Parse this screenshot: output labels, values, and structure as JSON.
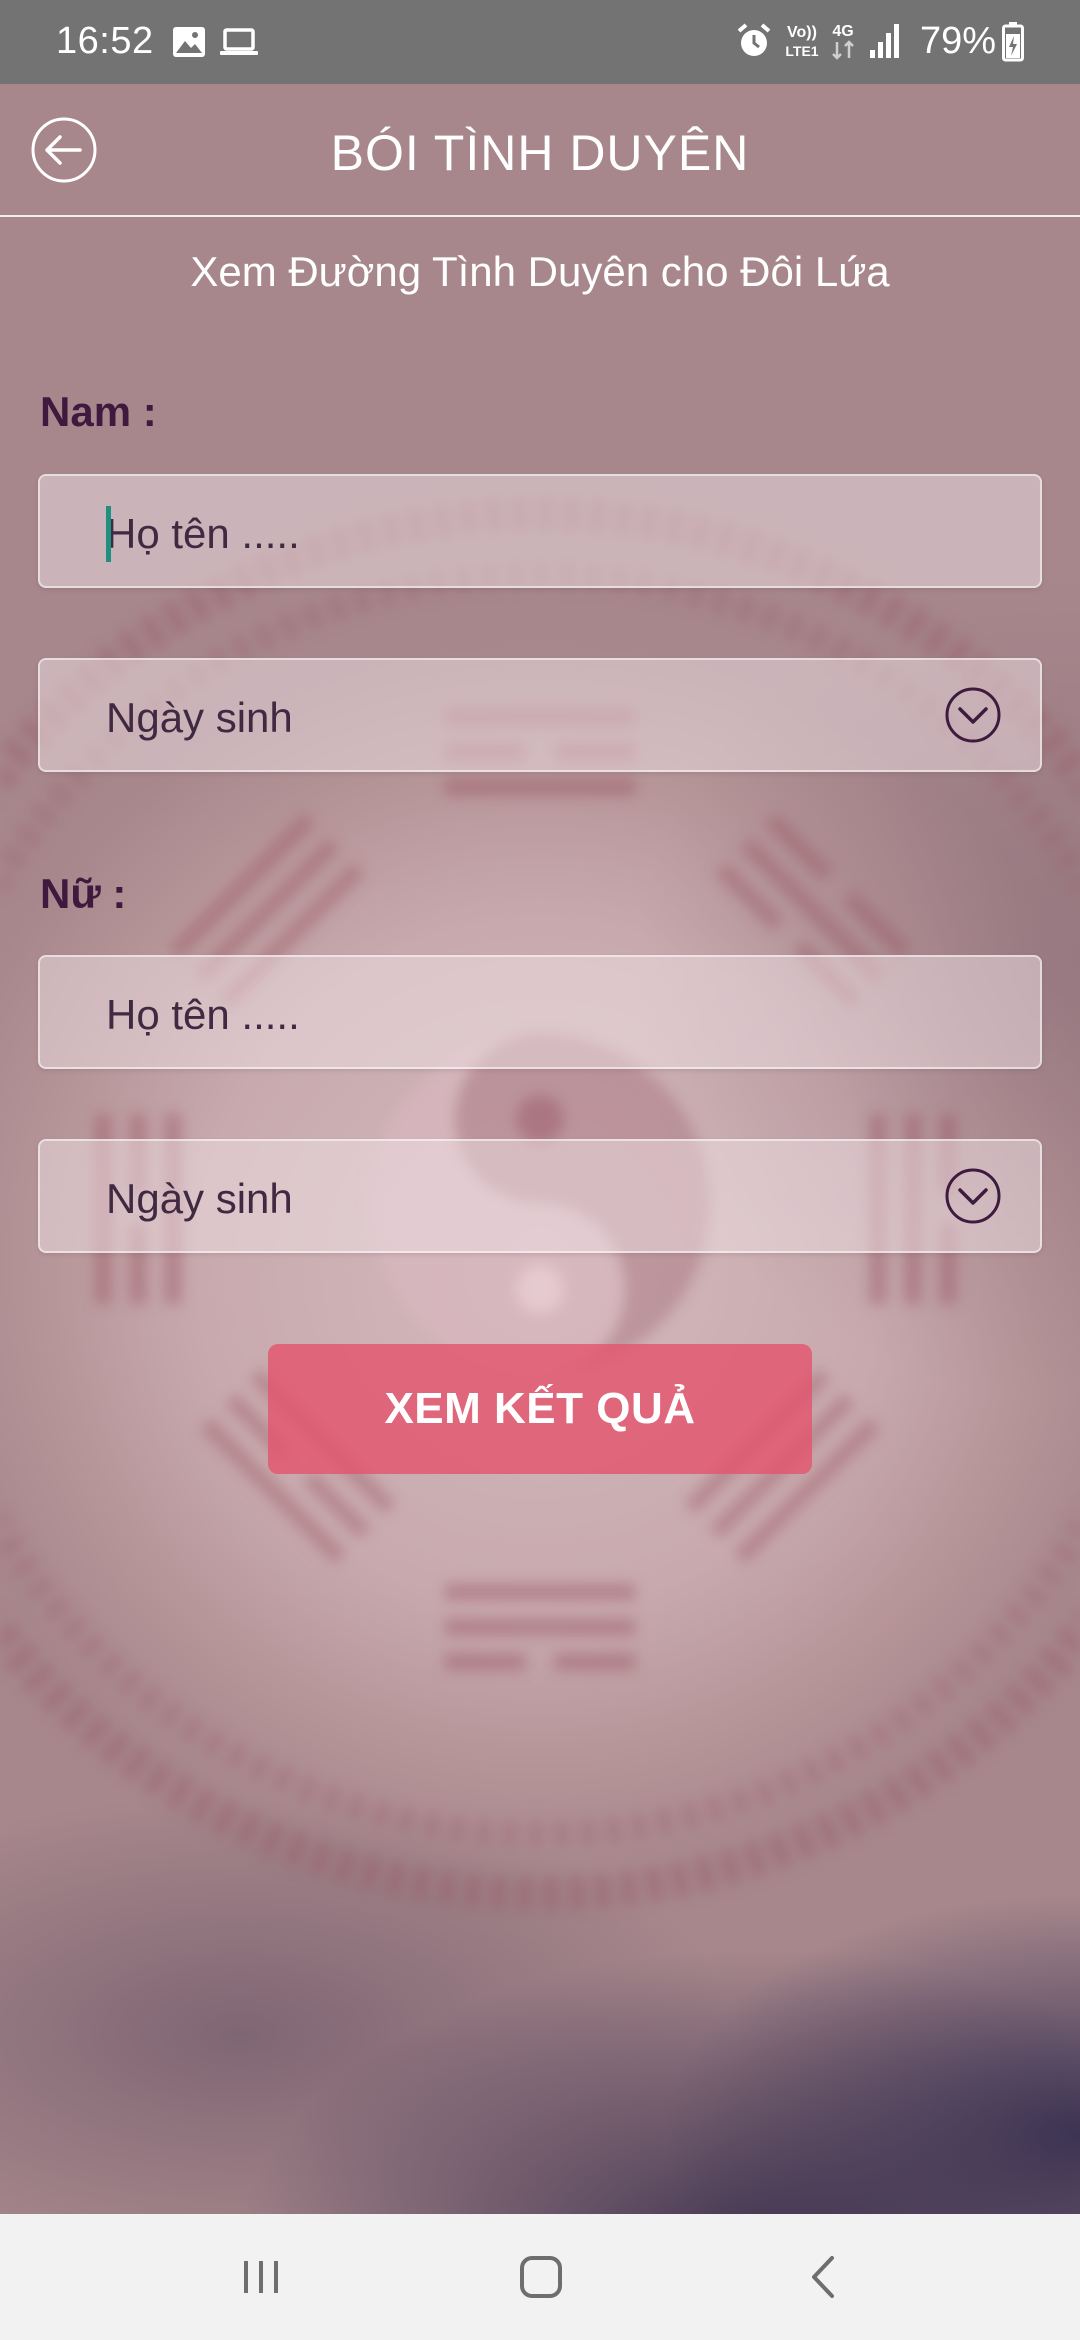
{
  "status_bar": {
    "time": "16:52",
    "battery": "79%",
    "icons": [
      "image-icon",
      "laptop-icon",
      "alarm-icon",
      "volte-icon",
      "4g-icon",
      "signal-icon",
      "battery-charging-icon"
    ],
    "volte_text": "Vo)) LTE1",
    "network_text": "4G"
  },
  "header": {
    "title": "BÓI TÌNH DUYÊN",
    "back_icon": "back-arrow-icon"
  },
  "subtitle": "Xem Đường Tình Duyên cho Đôi Lứa",
  "form": {
    "male": {
      "label": "Nam :",
      "name_placeholder": "Họ tên .....",
      "name_value": "",
      "birthdate_placeholder": "Ngày sinh"
    },
    "female": {
      "label": "Nữ :",
      "name_placeholder": "Họ tên .....",
      "name_value": "",
      "birthdate_placeholder": "Ngày sinh"
    },
    "submit_label": "XEM KẾT QUẢ"
  },
  "nav_bar": {
    "icons": [
      "recent-apps-icon",
      "home-icon",
      "back-icon"
    ]
  },
  "colors": {
    "status_bar": "#737373",
    "label_text": "#3e1b3e",
    "submit_button": "#e3566e",
    "nav_bar": "#f2f2f2"
  }
}
